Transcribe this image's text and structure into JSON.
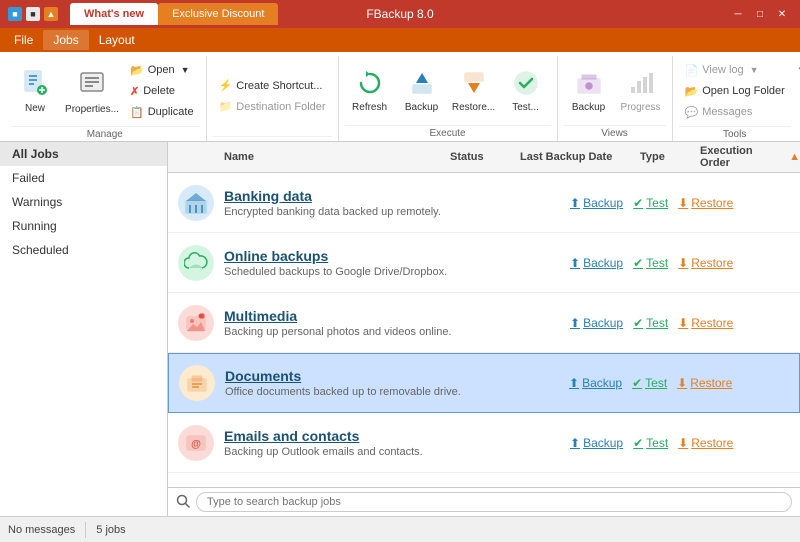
{
  "titleBar": {
    "tabs": [
      {
        "label": "What's new",
        "active": true
      },
      {
        "label": "Exclusive Discount",
        "active": false,
        "orange": true
      }
    ],
    "title": "FBackup 8.0",
    "windowControls": [
      "─",
      "□",
      "✕"
    ]
  },
  "menuBar": {
    "items": [
      "File",
      "Jobs",
      "Layout"
    ]
  },
  "ribbon": {
    "groups": [
      {
        "label": "Manage",
        "largeBtns": [
          {
            "id": "new",
            "icon": "📄",
            "label": "New",
            "color": "#2980b9"
          },
          {
            "id": "properties",
            "icon": "⚙",
            "label": "Properties...",
            "color": "#555"
          }
        ],
        "smallBtns": [
          {
            "id": "open",
            "icon": "📂",
            "label": "Open",
            "color": "#e67e22",
            "hasChevron": true
          },
          {
            "id": "delete",
            "icon": "✗",
            "label": "Delete",
            "color": "#e74c3c"
          },
          {
            "id": "duplicate",
            "icon": "📋",
            "label": "Duplicate",
            "color": "#3498db"
          }
        ]
      },
      {
        "label": "",
        "largeBtns": [],
        "smallBtns": [
          {
            "id": "create-shortcut",
            "icon": "⚡",
            "label": "Create Shortcut...",
            "color": "#555"
          },
          {
            "id": "dest-folder",
            "icon": "📁",
            "label": "Destination Folder",
            "color": "#888",
            "disabled": true
          }
        ]
      },
      {
        "label": "Execute",
        "largeBtns": [
          {
            "id": "refresh",
            "icon": "🔄",
            "label": "Refresh",
            "color": "#27ae60"
          },
          {
            "id": "backup",
            "icon": "⬆",
            "label": "Backup",
            "color": "#2980b9"
          },
          {
            "id": "restore",
            "icon": "⬇",
            "label": "Restore...",
            "color": "#e67e22"
          },
          {
            "id": "test",
            "icon": "✔",
            "label": "Test...",
            "color": "#27ae60"
          }
        ]
      },
      {
        "label": "Views",
        "largeBtns": [
          {
            "id": "backup2",
            "icon": "💾",
            "label": "Backup",
            "color": "#8e44ad"
          },
          {
            "id": "progress",
            "icon": "📊",
            "label": "Progress",
            "color": "#888"
          }
        ]
      },
      {
        "label": "Tools",
        "smallBtns": [
          {
            "id": "view-log",
            "icon": "📄",
            "label": "View log",
            "color": "#555",
            "disabled": true,
            "hasChevron": true
          },
          {
            "id": "open-log-folder",
            "icon": "📁",
            "label": "Open Log Folder",
            "color": "#e67e22"
          },
          {
            "id": "messages",
            "icon": "💬",
            "label": "Messages",
            "color": "#888",
            "disabled": true
          }
        ]
      }
    ]
  },
  "sidebar": {
    "items": [
      {
        "label": "All Jobs",
        "active": true
      },
      {
        "label": "Failed"
      },
      {
        "label": "Warnings"
      },
      {
        "label": "Running"
      },
      {
        "label": "Scheduled"
      }
    ]
  },
  "columnHeaders": {
    "name": "Name",
    "status": "Status",
    "lastBackupDate": "Last Backup Date",
    "type": "Type",
    "executionOrder": "Execution Order"
  },
  "jobs": [
    {
      "id": "banking",
      "name": "Banking data",
      "desc": "Encrypted banking data backed up remotely.",
      "iconColor": "#2980b9",
      "iconBg": "#d6eaf8",
      "icon": "🏦",
      "selected": false
    },
    {
      "id": "online",
      "name": "Online backups",
      "desc": "Scheduled backups to Google Drive/Dropbox.",
      "iconColor": "#27ae60",
      "iconBg": "#d5f5e3",
      "icon": "☁",
      "selected": false
    },
    {
      "id": "multimedia",
      "name": "Multimedia",
      "desc": "Backing up personal photos and videos online.",
      "iconColor": "#e74c3c",
      "iconBg": "#fadbd8",
      "icon": "📷",
      "selected": false
    },
    {
      "id": "documents",
      "name": "Documents",
      "desc": "Office documents backed up to removable drive.",
      "iconColor": "#e67e22",
      "iconBg": "#fdebd0",
      "icon": "💼",
      "selected": true
    },
    {
      "id": "emails",
      "name": "Emails and contacts",
      "desc": "Backing up Outlook emails and contacts.",
      "iconColor": "#e74c3c",
      "iconBg": "#fadbd8",
      "icon": "@",
      "selected": false
    }
  ],
  "actions": {
    "backup": "Backup",
    "test": "Test",
    "restore": "Restore"
  },
  "searchBar": {
    "placeholder": "Type to search backup jobs"
  },
  "statusBar": {
    "messages": "No messages",
    "jobCount": "5 jobs"
  }
}
